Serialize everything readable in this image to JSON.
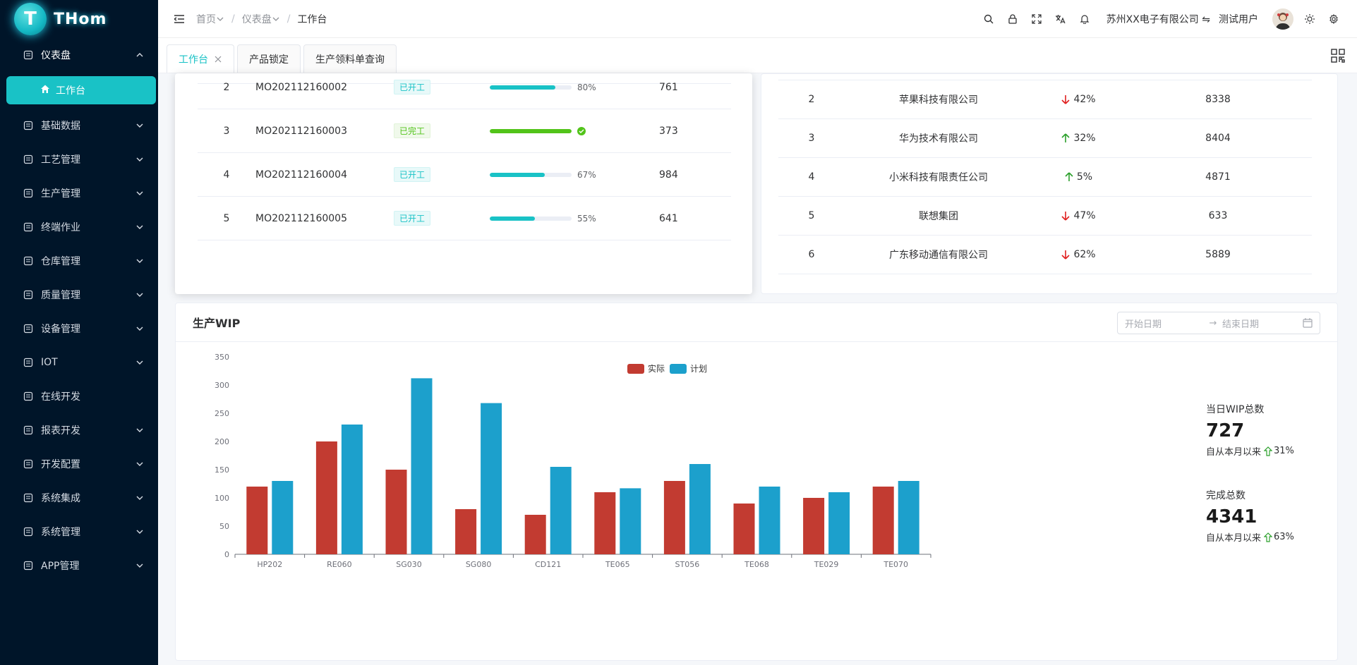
{
  "logo": {
    "letter": "T",
    "text": "THom"
  },
  "sidebar": {
    "items": [
      {
        "label": "仪表盘",
        "icon": "dashboard-icon",
        "open": true
      },
      {
        "label": "基础数据",
        "icon": "database-icon"
      },
      {
        "label": "工艺管理",
        "icon": "process-icon"
      },
      {
        "label": "生产管理",
        "icon": "production-icon"
      },
      {
        "label": "终端作业",
        "icon": "terminal-icon"
      },
      {
        "label": "仓库管理",
        "icon": "warehouse-icon"
      },
      {
        "label": "质量管理",
        "icon": "quality-icon"
      },
      {
        "label": "设备管理",
        "icon": "device-icon"
      },
      {
        "label": "IOT",
        "icon": "iot-icon"
      },
      {
        "label": "在线开发",
        "icon": "online-dev-icon"
      },
      {
        "label": "报表开发",
        "icon": "report-icon"
      },
      {
        "label": "开发配置",
        "icon": "dev-config-icon"
      },
      {
        "label": "系统集成",
        "icon": "integration-icon"
      },
      {
        "label": "系统管理",
        "icon": "system-icon"
      },
      {
        "label": "APP管理",
        "icon": "app-icon"
      }
    ],
    "active_sub": "工作台"
  },
  "header": {
    "breadcrumb": [
      "首页",
      "仪表盘",
      "工作台"
    ],
    "company": "苏州XX电子有限公司",
    "user": "测试用户"
  },
  "tabs": [
    {
      "label": "工作台",
      "active": true
    },
    {
      "label": "产品锁定"
    },
    {
      "label": "生产领料单查询"
    }
  ],
  "orders": [
    {
      "no": "2",
      "code": "MO202112160002",
      "status": "已开工",
      "progress": 80,
      "pct": "80%",
      "qty": "761"
    },
    {
      "no": "3",
      "code": "MO202112160003",
      "status": "已完工",
      "progress": 100,
      "done": true,
      "qty": "373"
    },
    {
      "no": "4",
      "code": "MO202112160004",
      "status": "已开工",
      "progress": 67,
      "pct": "67%",
      "qty": "984"
    },
    {
      "no": "5",
      "code": "MO202112160005",
      "status": "已开工",
      "progress": 55,
      "pct": "55%",
      "qty": "641"
    }
  ],
  "customers": [
    {
      "no": "2",
      "name": "苹果科技有限公司",
      "trend": "down",
      "pct": "42%",
      "value": "8338"
    },
    {
      "no": "3",
      "name": "华为技术有限公司",
      "trend": "up",
      "pct": "32%",
      "value": "8404"
    },
    {
      "no": "4",
      "name": "小米科技有限责任公司",
      "trend": "up",
      "pct": "5%",
      "value": "4871"
    },
    {
      "no": "5",
      "name": "联想集团",
      "trend": "down",
      "pct": "47%",
      "value": "633"
    },
    {
      "no": "6",
      "name": "广东移动通信有限公司",
      "trend": "down",
      "pct": "62%",
      "value": "5889"
    }
  ],
  "wip": {
    "title": "生产WIP",
    "start_placeholder": "开始日期",
    "range_sep": "→",
    "end_placeholder": "结束日期",
    "stats": [
      {
        "label": "当日WIP总数",
        "value": "727",
        "sub": "自从本月以来",
        "pct": "31%"
      },
      {
        "label": "完成总数",
        "value": "4341",
        "sub": "自从本月以来",
        "pct": "63%"
      }
    ]
  },
  "colors": {
    "accent": "#19c2c6",
    "actual": "#c23b31",
    "plan": "#1ca0cc",
    "up": "#2ca02c",
    "down": "#e02020"
  },
  "chart_data": {
    "type": "bar",
    "categories": [
      "HP202",
      "RE060",
      "SG030",
      "SG080",
      "CD121",
      "TE065",
      "ST056",
      "TE068",
      "TE029",
      "TE070"
    ],
    "series": [
      {
        "name": "实际",
        "values": [
          120,
          200,
          150,
          80,
          70,
          110,
          130,
          90,
          100,
          120
        ]
      },
      {
        "name": "计划",
        "values": [
          130,
          230,
          312,
          268,
          155,
          117,
          160,
          120,
          110,
          130
        ]
      }
    ],
    "ylim": [
      0,
      350
    ],
    "yticks": [
      0,
      50,
      100,
      150,
      200,
      250,
      300,
      350
    ],
    "legend": "top-center",
    "grid": false
  }
}
